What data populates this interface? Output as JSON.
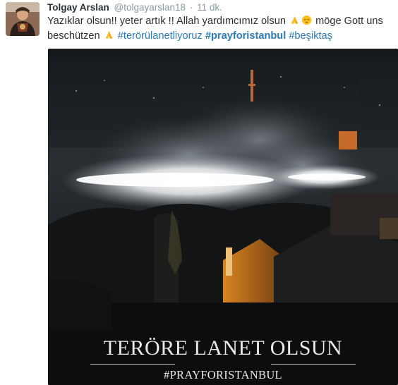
{
  "author": {
    "fullname": "Tolgay Arslan",
    "handle": "@tolgayarslan18",
    "separator": "·",
    "time": "11 dk."
  },
  "tweet": {
    "line1_text": "Yazıklar olsun!! yeter artık !! Allah yardımcımız olsun",
    "line1_after": "möge Gott uns",
    "line2_text": "beschützen",
    "hashtag1": "#terörülanetliyoruz",
    "hashtag2": "#prayforistanbul",
    "hashtag3": "#beşiktaş"
  },
  "media": {
    "caption_main": "TERÖRE LANET OLSUN",
    "caption_sub": "#PRAYFORISTANBUL"
  },
  "colors": {
    "link": "#2b7bb9",
    "text": "#292f33",
    "muted": "#8899a6",
    "emoji_yellow": "#fcc21b"
  },
  "icons": [
    "praying-hands-emoji",
    "pensive-face-emoji"
  ]
}
